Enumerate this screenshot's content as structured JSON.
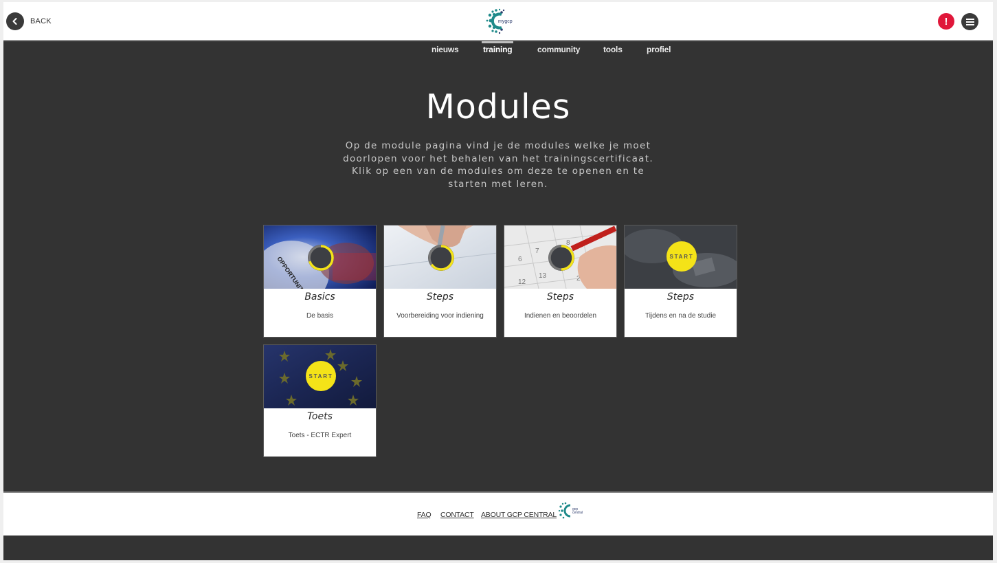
{
  "header": {
    "back_label": "BACK",
    "logo_text": "mygcp",
    "alert_icon": "!",
    "menu_icon": "hamburger-icon"
  },
  "nav": {
    "items": [
      {
        "label": "nieuws",
        "active": false
      },
      {
        "label": "training",
        "active": true
      },
      {
        "label": "community",
        "active": false
      },
      {
        "label": "tools",
        "active": false
      },
      {
        "label": "profiel",
        "active": false
      }
    ]
  },
  "main": {
    "title": "Modules",
    "intro": "Op de module pagina vind je de modules welke je moet doorlopen voor het behalen van het trainingscertificaat. Klik op een van de modules om deze te openen en te starten met leren."
  },
  "modules": [
    {
      "title": "Basics",
      "subtitle": "De basis",
      "state": "progress",
      "progress": 0.7,
      "image": "pocket-watch-opportunities"
    },
    {
      "title": "Steps",
      "subtitle": "Voorbereiding voor indiening",
      "state": "progress",
      "progress": 0.65,
      "image": "hand-signing-document"
    },
    {
      "title": "Steps",
      "subtitle": "Indienen en beoordelen",
      "state": "progress",
      "progress": 0.5,
      "image": "calendar-red-pen"
    },
    {
      "title": "Steps",
      "subtitle": "Tijdens en na de studie",
      "state": "start",
      "start_label": "START",
      "image": "hands-with-pills"
    },
    {
      "title": "Toets",
      "subtitle": "Toets - ECTR Expert",
      "state": "start",
      "start_label": "START",
      "image": "eu-flag"
    }
  ],
  "footer": {
    "links": [
      "FAQ",
      "CONTACT",
      "ABOUT GCP CENTRAL"
    ],
    "logo_text": "gcp central"
  },
  "colors": {
    "accent_yellow": "#f4e318",
    "alert_red": "#e0173a",
    "background_dark": "#333333",
    "logo_teal": "#1f8a8a",
    "logo_navy": "#2b3a6b"
  }
}
